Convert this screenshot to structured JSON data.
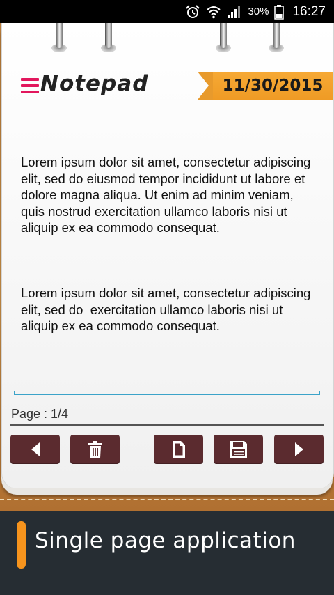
{
  "status_bar": {
    "battery_percent": "30%",
    "time": "16:27",
    "icons": [
      "alarm-icon",
      "wifi-icon",
      "signal-icon",
      "battery-icon"
    ]
  },
  "header": {
    "title": "Notepad",
    "date": "11/30/2015",
    "menu_icon": "menu-icon",
    "accent_color": "#e2175d",
    "ribbon_color": "#f6a935"
  },
  "note": {
    "paragraphs": [
      "Lorem ipsum dolor sit amet, consectetur adipiscing elit, sed do eiusmod tempor incididunt ut labore et dolore magna aliqua. Ut enim ad minim veniam, quis nostrud exercitation ullamco laboris nisi ut aliquip ex ea commodo consequat.",
      "Lorem ipsum dolor sit amet, consectetur adipiscing elit, sed do  exercitation ullamco laboris nisi ut aliquip ex ea commodo consequat."
    ]
  },
  "pagination": {
    "label": "Page : 1/4"
  },
  "toolbar": {
    "button_color": "#5b2b2f",
    "buttons": [
      {
        "name": "previous-page-button",
        "icon": "triangle-left-icon"
      },
      {
        "name": "delete-button",
        "icon": "trash-icon"
      },
      {
        "name": "new-page-button",
        "icon": "document-icon"
      },
      {
        "name": "save-button",
        "icon": "floppy-disk-icon"
      },
      {
        "name": "next-page-button",
        "icon": "triangle-right-icon"
      }
    ]
  },
  "banner": {
    "text": "Single page application",
    "accent_color": "#f7941d"
  }
}
